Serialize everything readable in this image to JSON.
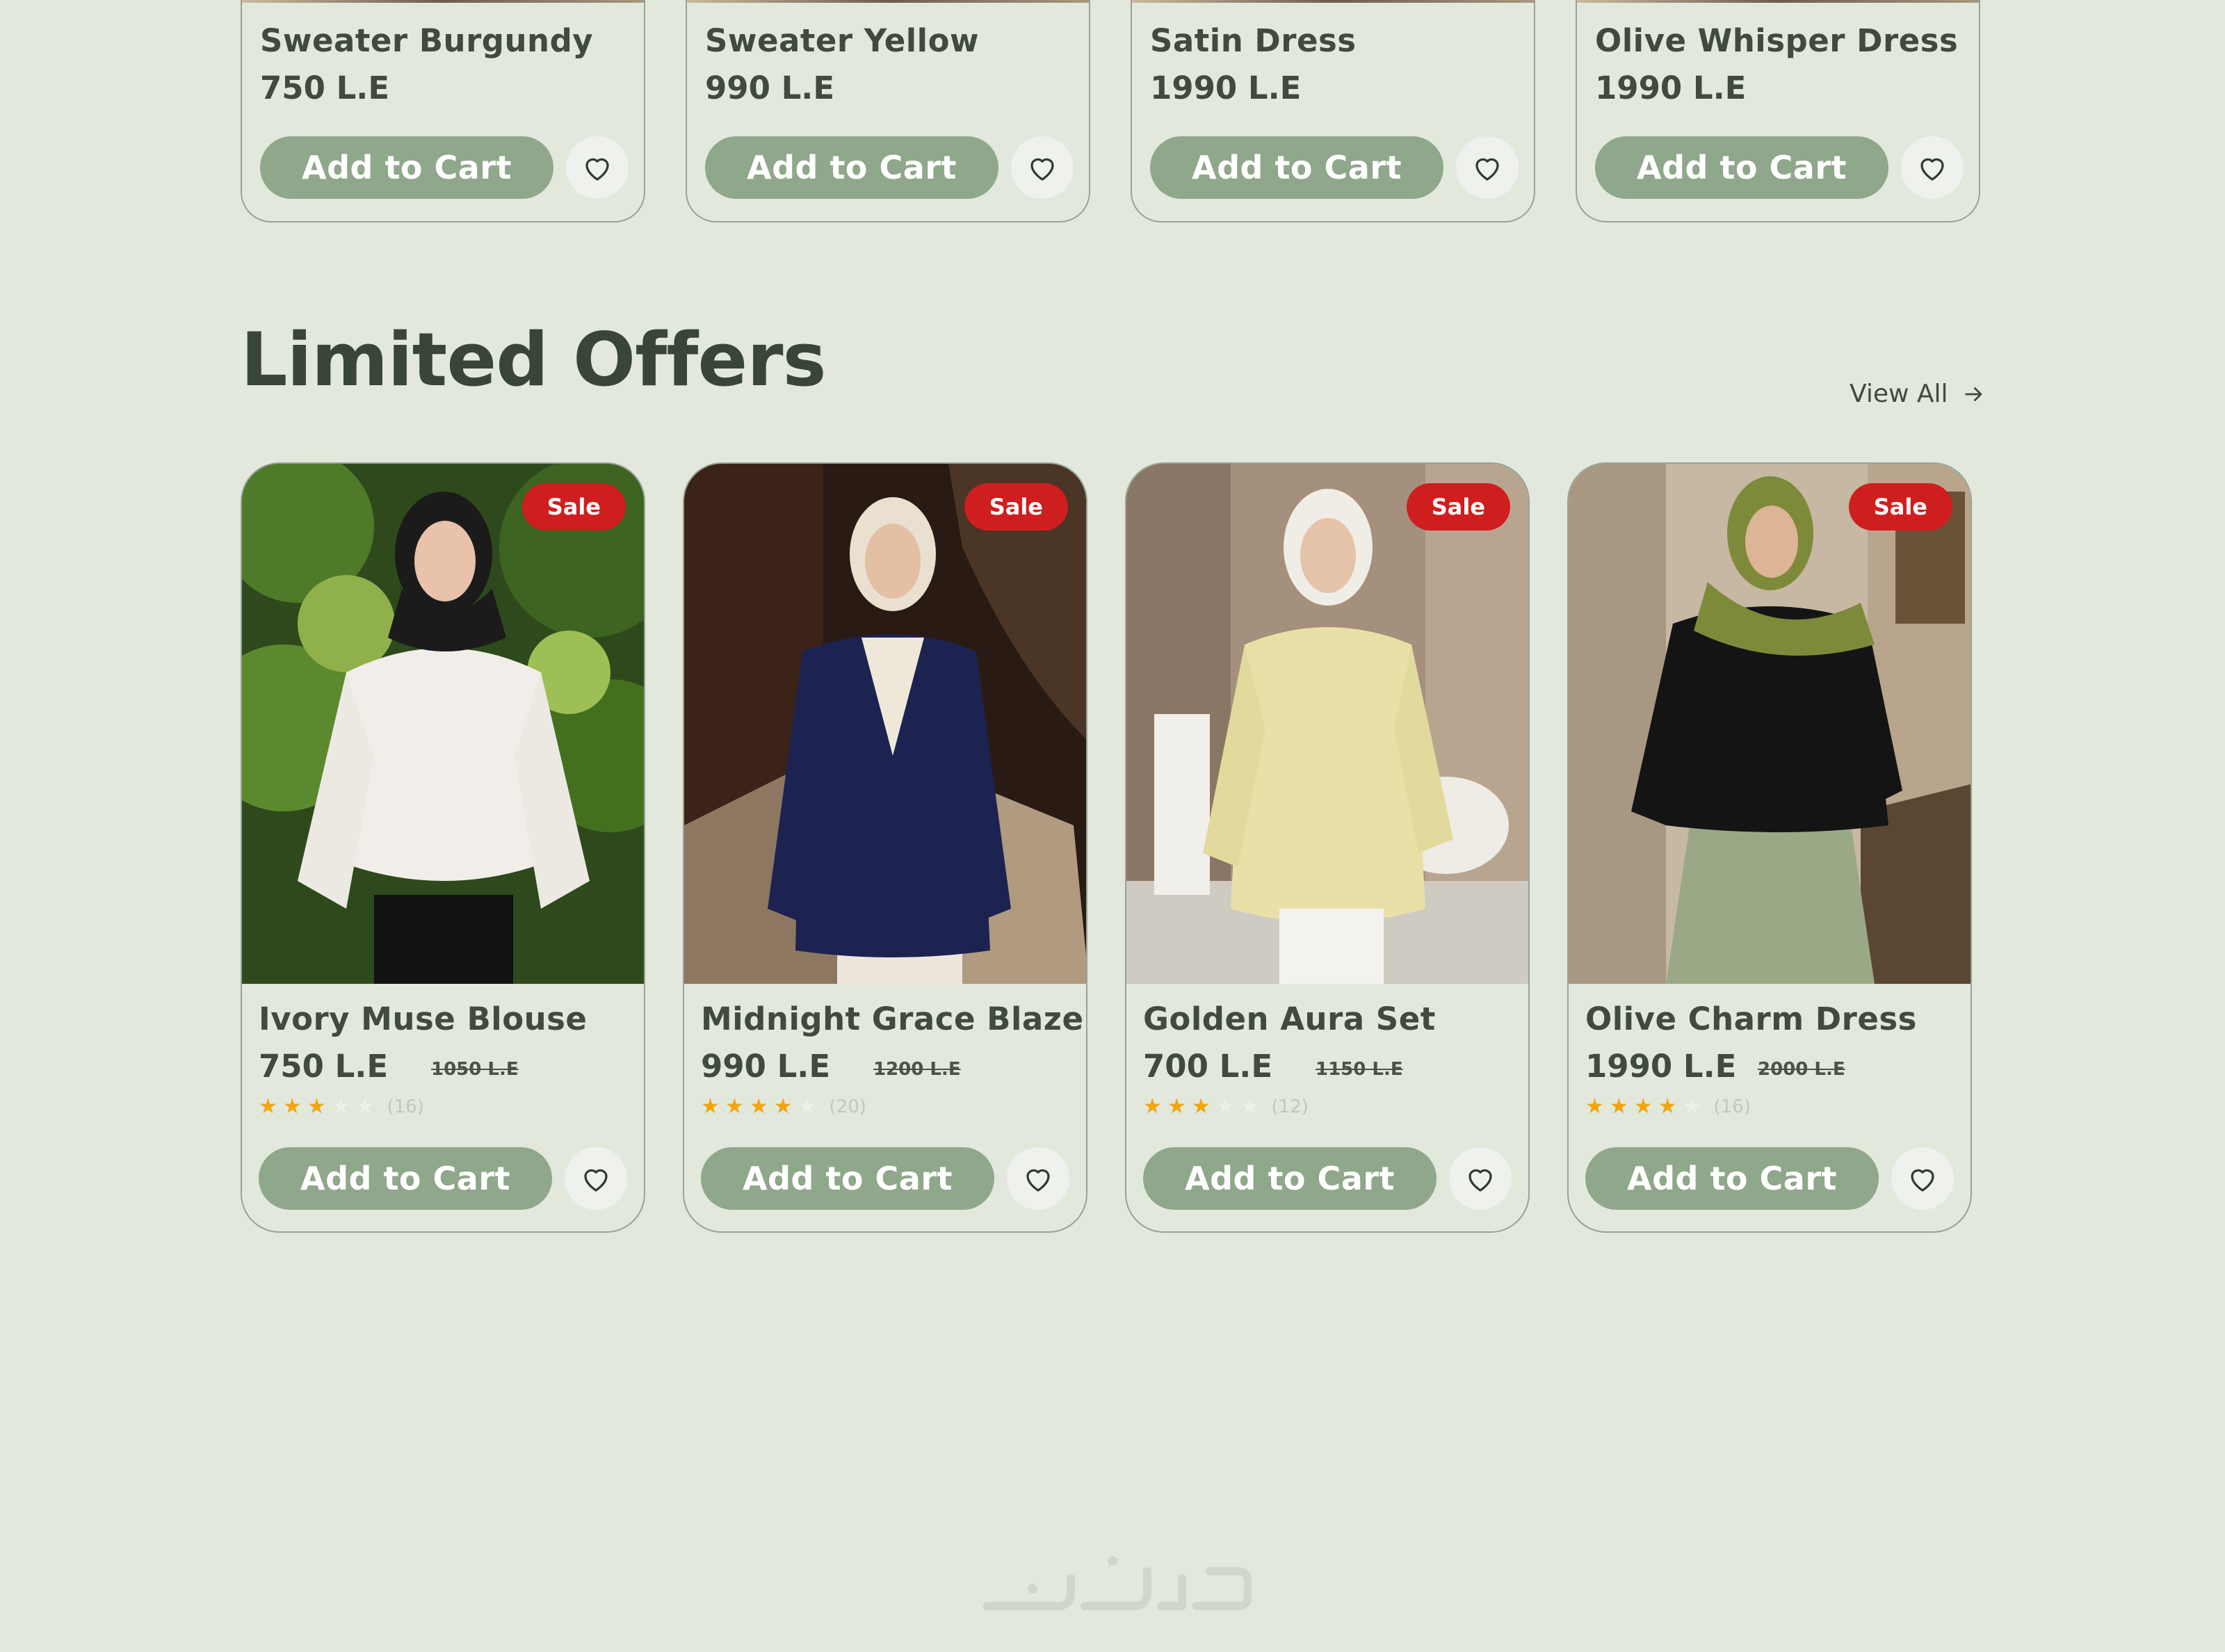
{
  "top_products": [
    {
      "name": "Sweater Burgundy",
      "price": "750 L.E",
      "cart_label": "Add to Cart"
    },
    {
      "name": "Sweater Yellow",
      "price": "990 L.E",
      "cart_label": "Add to Cart"
    },
    {
      "name": "Satin Dress",
      "price": "1990 L.E",
      "cart_label": "Add to Cart"
    },
    {
      "name": "Olive Whisper Dress",
      "price": "1990 L.E",
      "cart_label": "Add to Cart"
    }
  ],
  "limited_offers": {
    "title": "Limited Offers",
    "view_all_label": "View All",
    "products": [
      {
        "name": "Ivory Muse Blouse",
        "price": "750 L.E",
        "old_price": "1050 L.E",
        "rating": 3,
        "reviews": "(16)",
        "badge": "Sale",
        "cart_label": "Add to Cart"
      },
      {
        "name": "Midnight Grace Blazer",
        "price": "990 L.E",
        "old_price": "1200 L.E",
        "rating": 4,
        "reviews": "(20)",
        "badge": "Sale",
        "cart_label": "Add to Cart"
      },
      {
        "name": "Golden Aura Set",
        "price": "700 L.E",
        "old_price": "1150 L.E",
        "rating": 3,
        "reviews": "(12)",
        "badge": "Sale",
        "cart_label": "Add to Cart"
      },
      {
        "name": "Olive Charm Dress",
        "price": "1990 L.E",
        "old_price": "2000 L.E",
        "rating": 4,
        "reviews": "(16)",
        "badge": "Sale",
        "cart_label": "Add to Cart"
      }
    ]
  },
  "footer": {
    "logo_text": "خمسات"
  },
  "colors": {
    "background": "#e2e8dc",
    "accent_button": "#8fa78a",
    "sale_badge": "#cf1e1e",
    "star": "#f2a50c",
    "text": "#3b453b"
  },
  "icons": [
    "heart-icon",
    "arrow-right-icon",
    "star-icon"
  ]
}
